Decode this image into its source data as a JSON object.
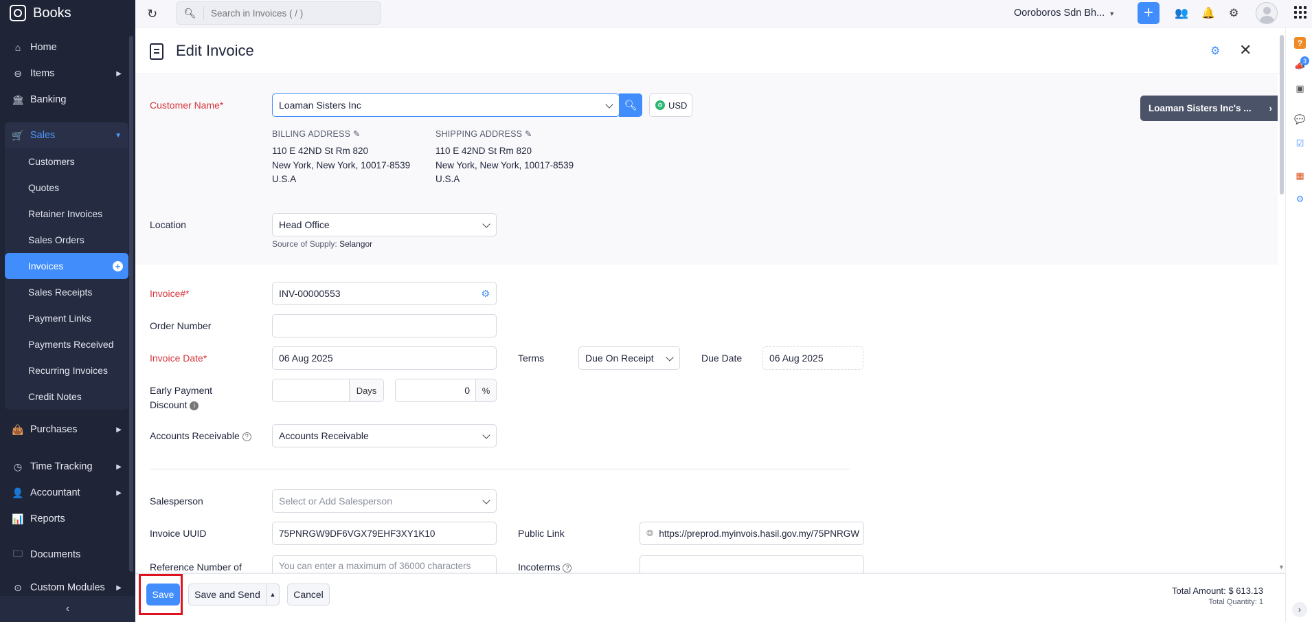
{
  "app": {
    "brand": "Books"
  },
  "sidebar": {
    "home": "Home",
    "items": "Items",
    "banking": "Banking",
    "sales": "Sales",
    "sales_sub": [
      "Customers",
      "Quotes",
      "Retainer Invoices",
      "Sales Orders",
      "Invoices",
      "Sales Receipts",
      "Payment Links",
      "Payments Received",
      "Recurring Invoices",
      "Credit Notes"
    ],
    "purchases": "Purchases",
    "time_tracking": "Time Tracking",
    "accountant": "Accountant",
    "reports": "Reports",
    "documents": "Documents",
    "custom_modules": "Custom Modules",
    "collapse_glyph": "‹"
  },
  "topbar": {
    "search_placeholder": "Search in Invoices ( / )",
    "org_name": "Ooroboros Sdn Bh...",
    "rail_badge_count": "3"
  },
  "page": {
    "title": "Edit Invoice"
  },
  "customer": {
    "label": "Customer Name*",
    "value": "Loaman Sisters Inc",
    "currency": "USD",
    "panel_label": "Loaman Sisters Inc's ...",
    "billing_title": "BILLING ADDRESS",
    "shipping_title": "SHIPPING ADDRESS",
    "billing_lines": [
      "110 E 42ND St Rm 820",
      "New York, New York, 10017-8539",
      "U.S.A"
    ],
    "shipping_lines": [
      "110 E 42ND St Rm 820",
      "New York, New York, 10017-8539",
      "U.S.A"
    ]
  },
  "location": {
    "label": "Location",
    "value": "Head Office",
    "source_prefix": "Source of Supply:",
    "source_value": "Selangor"
  },
  "invoice": {
    "number_label": "Invoice#*",
    "number_value": "INV-00000553",
    "order_label": "Order Number",
    "order_value": "",
    "date_label": "Invoice Date*",
    "date_value": "06 Aug 2025",
    "terms_label": "Terms",
    "terms_value": "Due On Receipt",
    "due_label": "Due Date",
    "due_value": "06 Aug 2025",
    "early_label_1": "Early Payment",
    "early_label_2": "Discount",
    "days_value": "",
    "days_suffix": "Days",
    "percent_value": "0",
    "percent_suffix": "%",
    "ar_label": "Accounts Receivable",
    "ar_value": "Accounts Receivable",
    "salesperson_label": "Salesperson",
    "salesperson_placeholder": "Select or Add Salesperson",
    "uuid_label": "Invoice UUID",
    "uuid_value": "75PNRGW9DF6VGX79EHF3XY1K10",
    "public_link_label": "Public Link",
    "public_link_value": "https://preprod.myinvois.hasil.gov.my/75PNRGW",
    "ref_label": "Reference Number of",
    "ref_placeholder": "You can enter a maximum of 36000 characters",
    "incoterms_label": "Incoterms"
  },
  "footer": {
    "save": "Save",
    "save_send": "Save and Send",
    "cancel": "Cancel",
    "total_amount": "Total Amount: $ 613.13",
    "total_quantity": "Total Quantity: 1"
  }
}
